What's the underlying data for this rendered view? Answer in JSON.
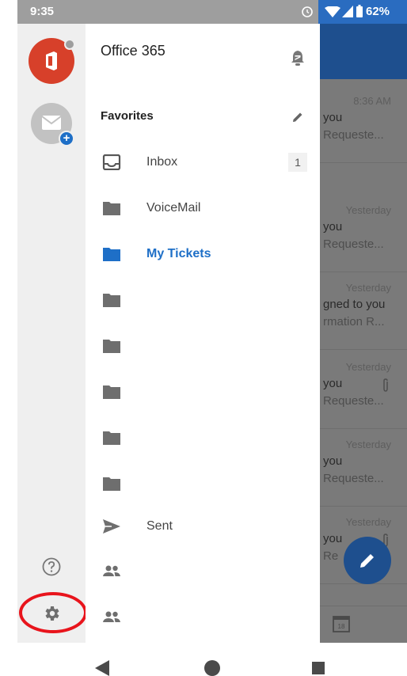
{
  "status_bar": {
    "time": "9:35",
    "battery": "62%"
  },
  "drawer": {
    "account_title": "Office 365",
    "favorites_label": "Favorites",
    "folders": [
      {
        "label": "Inbox",
        "icon": "inbox-icon",
        "count": "1",
        "active": false
      },
      {
        "label": "VoiceMail",
        "icon": "folder-icon",
        "active": false
      },
      {
        "label": "My Tickets",
        "icon": "folder-icon",
        "active": true
      },
      {
        "label": "",
        "icon": "folder-icon",
        "active": false
      },
      {
        "label": "",
        "icon": "folder-icon",
        "active": false
      },
      {
        "label": "",
        "icon": "folder-icon",
        "active": false
      },
      {
        "label": "",
        "icon": "folder-icon",
        "active": false
      },
      {
        "label": "",
        "icon": "folder-icon",
        "active": false
      },
      {
        "label": "Sent",
        "icon": "send-icon",
        "active": false
      },
      {
        "label": "",
        "icon": "group-icon",
        "active": false
      },
      {
        "label": "",
        "icon": "group-icon",
        "active": false
      }
    ]
  },
  "message_list": {
    "messages": [
      {
        "time": "8:36 AM",
        "subject": "you",
        "preview": "Requeste..."
      },
      {
        "time": "Yesterday",
        "subject": "you",
        "preview": "Requeste..."
      },
      {
        "time": "Yesterday",
        "subject": "gned to you",
        "preview": "rmation R..."
      },
      {
        "time": "Yesterday",
        "subject": "you",
        "preview": "Requeste..."
      },
      {
        "time": "Yesterday",
        "subject": "you",
        "preview": "Requeste..."
      },
      {
        "time": "Yesterday",
        "subject": "you",
        "preview": "Re"
      }
    ],
    "calendar_day": "18"
  },
  "colors": {
    "accent": "#1e6fc7",
    "office_red": "#d7402a",
    "highlight_circle": "#e8141c"
  }
}
